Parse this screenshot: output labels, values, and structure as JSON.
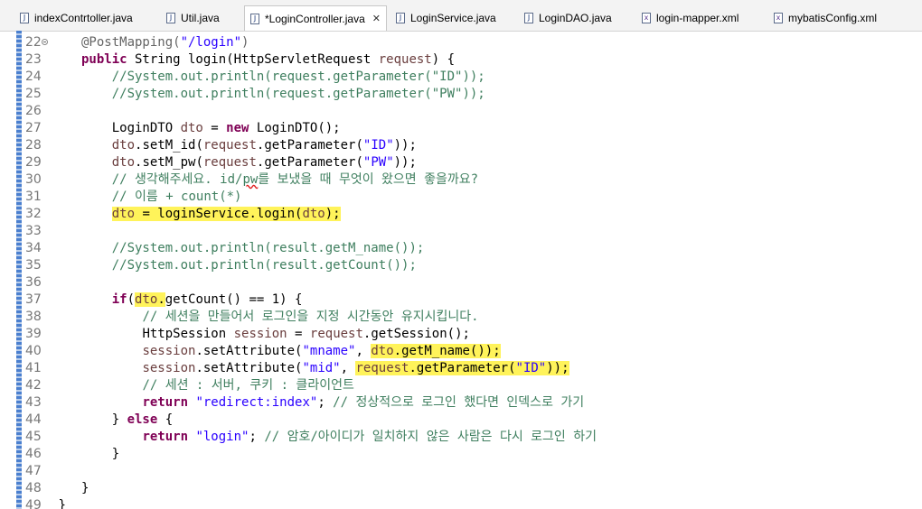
{
  "tabs": [
    {
      "label": "indexContrtoller.java",
      "icon": "java-file-icon"
    },
    {
      "label": "Util.java",
      "icon": "java-file-icon"
    },
    {
      "label": "*LoginController.java",
      "icon": "java-file-icon",
      "active": true
    },
    {
      "label": "LoginService.java",
      "icon": "java-file-icon"
    },
    {
      "label": "LoginDAO.java",
      "icon": "java-file-icon"
    },
    {
      "label": "login-mapper.xml",
      "icon": "xml-file-icon"
    },
    {
      "label": "mybatisConfig.xml",
      "icon": "xml-file-icon"
    }
  ],
  "icon_glyphs": {
    "java": "J",
    "xml": "x",
    "close": "✕"
  },
  "highlight_color": "#fff35a",
  "lines": [
    {
      "n": "22",
      "fold": true,
      "indent": "",
      "tokens": [
        {
          "t": "@PostMapping(",
          "c": "ann"
        },
        {
          "t": "\"/login\"",
          "c": "str"
        },
        {
          "t": ")",
          "c": "ann"
        }
      ]
    },
    {
      "n": "23",
      "indent": "",
      "tokens": [
        {
          "t": "public",
          "c": "kw"
        },
        {
          "t": " String login(HttpServletRequest "
        },
        {
          "t": "request",
          "c": "var"
        },
        {
          "t": ") {"
        }
      ]
    },
    {
      "n": "24",
      "indent": "    ",
      "tokens": [
        {
          "t": "//System.out.println(request.getParameter(\"ID\"));",
          "c": "cm"
        }
      ]
    },
    {
      "n": "25",
      "indent": "    ",
      "tokens": [
        {
          "t": "//System.out.println(request.getParameter(\"PW\"));",
          "c": "cm"
        }
      ]
    },
    {
      "n": "26",
      "indent": "",
      "tokens": []
    },
    {
      "n": "27",
      "indent": "    ",
      "tokens": [
        {
          "t": "LoginDTO "
        },
        {
          "t": "dto",
          "c": "var"
        },
        {
          "t": " = "
        },
        {
          "t": "new",
          "c": "kw"
        },
        {
          "t": " LoginDTO();"
        }
      ]
    },
    {
      "n": "28",
      "indent": "    ",
      "tokens": [
        {
          "t": "dto",
          "c": "var"
        },
        {
          "t": ".setM_id("
        },
        {
          "t": "request",
          "c": "var"
        },
        {
          "t": ".getParameter("
        },
        {
          "t": "\"ID\"",
          "c": "str"
        },
        {
          "t": "));"
        }
      ]
    },
    {
      "n": "29",
      "indent": "    ",
      "tokens": [
        {
          "t": "dto",
          "c": "var"
        },
        {
          "t": ".setM_pw("
        },
        {
          "t": "request",
          "c": "var"
        },
        {
          "t": ".getParameter("
        },
        {
          "t": "\"PW\"",
          "c": "str"
        },
        {
          "t": "));"
        }
      ]
    },
    {
      "n": "30",
      "indent": "    ",
      "tokens": [
        {
          "t": "// 생각해주세요. id/",
          "c": "cm"
        },
        {
          "t": "pw",
          "c": "cm squig"
        },
        {
          "t": "를 보냈을 때 무엇이 왔으면 좋을까요?",
          "c": "cm"
        }
      ]
    },
    {
      "n": "31",
      "indent": "    ",
      "tokens": [
        {
          "t": "// 이름 + count(*)",
          "c": "cm"
        }
      ]
    },
    {
      "n": "32",
      "indent": "    ",
      "tokens": [
        {
          "t": "dto",
          "c": "var hl"
        },
        {
          "t": " = loginService.login(",
          "c": "hl"
        },
        {
          "t": "dto",
          "c": "var hl"
        },
        {
          "t": ");",
          "c": "hl"
        }
      ]
    },
    {
      "n": "33",
      "indent": "",
      "tokens": []
    },
    {
      "n": "34",
      "indent": "    ",
      "tokens": [
        {
          "t": "//System.out.println(result.getM_name());",
          "c": "cm"
        }
      ]
    },
    {
      "n": "35",
      "indent": "    ",
      "tokens": [
        {
          "t": "//System.out.println(result.getCount());",
          "c": "cm"
        }
      ]
    },
    {
      "n": "36",
      "indent": "",
      "tokens": []
    },
    {
      "n": "37",
      "indent": "    ",
      "tokens": [
        {
          "t": "if",
          "c": "kw"
        },
        {
          "t": "("
        },
        {
          "t": "dto",
          "c": "var hl"
        },
        {
          "t": ".",
          "c": "hl"
        },
        {
          "t": "getCount() == 1) {"
        }
      ]
    },
    {
      "n": "38",
      "indent": "        ",
      "tokens": [
        {
          "t": "// 세션을 만들어서 로그인을 지정 시간동안 유지시킵니다.",
          "c": "cm"
        }
      ]
    },
    {
      "n": "39",
      "indent": "        ",
      "tokens": [
        {
          "t": "HttpSession "
        },
        {
          "t": "session",
          "c": "var"
        },
        {
          "t": " = "
        },
        {
          "t": "request",
          "c": "var"
        },
        {
          "t": ".getSession();"
        }
      ]
    },
    {
      "n": "40",
      "indent": "        ",
      "tokens": [
        {
          "t": "session",
          "c": "var"
        },
        {
          "t": ".setAttribute("
        },
        {
          "t": "\"mname\"",
          "c": "str"
        },
        {
          "t": ", "
        },
        {
          "t": "dto",
          "c": "var hl"
        },
        {
          "t": ".getM_name());",
          "c": "hl"
        }
      ]
    },
    {
      "n": "41",
      "indent": "        ",
      "tokens": [
        {
          "t": "session",
          "c": "var"
        },
        {
          "t": ".setAttribute("
        },
        {
          "t": "\"mid\"",
          "c": "str"
        },
        {
          "t": ", "
        },
        {
          "t": "request",
          "c": "var hl"
        },
        {
          "t": ".getParameter(",
          "c": "hl"
        },
        {
          "t": "\"ID\"",
          "c": "str hl"
        },
        {
          "t": "));",
          "c": "hl"
        }
      ]
    },
    {
      "n": "42",
      "indent": "        ",
      "tokens": [
        {
          "t": "// 세션 : 서버, 쿠키 : 클라이언트",
          "c": "cm"
        }
      ]
    },
    {
      "n": "43",
      "indent": "        ",
      "tokens": [
        {
          "t": "return",
          "c": "kw"
        },
        {
          "t": " "
        },
        {
          "t": "\"redirect:index\"",
          "c": "str"
        },
        {
          "t": "; "
        },
        {
          "t": "// 정상적으로 로그인 했다면 인덱스로 가기",
          "c": "cm"
        }
      ]
    },
    {
      "n": "44",
      "indent": "    ",
      "tokens": [
        {
          "t": "} "
        },
        {
          "t": "else",
          "c": "kw"
        },
        {
          "t": " {"
        }
      ]
    },
    {
      "n": "45",
      "indent": "        ",
      "tokens": [
        {
          "t": "return",
          "c": "kw"
        },
        {
          "t": " "
        },
        {
          "t": "\"login\"",
          "c": "str"
        },
        {
          "t": "; "
        },
        {
          "t": "// 암호/아이디가 일치하지 않은 사람은 다시 로그인 하기",
          "c": "cm"
        }
      ]
    },
    {
      "n": "46",
      "indent": "    ",
      "tokens": [
        {
          "t": "}"
        }
      ]
    },
    {
      "n": "47",
      "indent": "",
      "tokens": []
    },
    {
      "n": "48",
      "indent": "",
      "tokens": [
        {
          "t": "}"
        }
      ]
    },
    {
      "n": "49",
      "indent": "-",
      "tokens": [
        {
          "t": "}"
        }
      ]
    }
  ]
}
